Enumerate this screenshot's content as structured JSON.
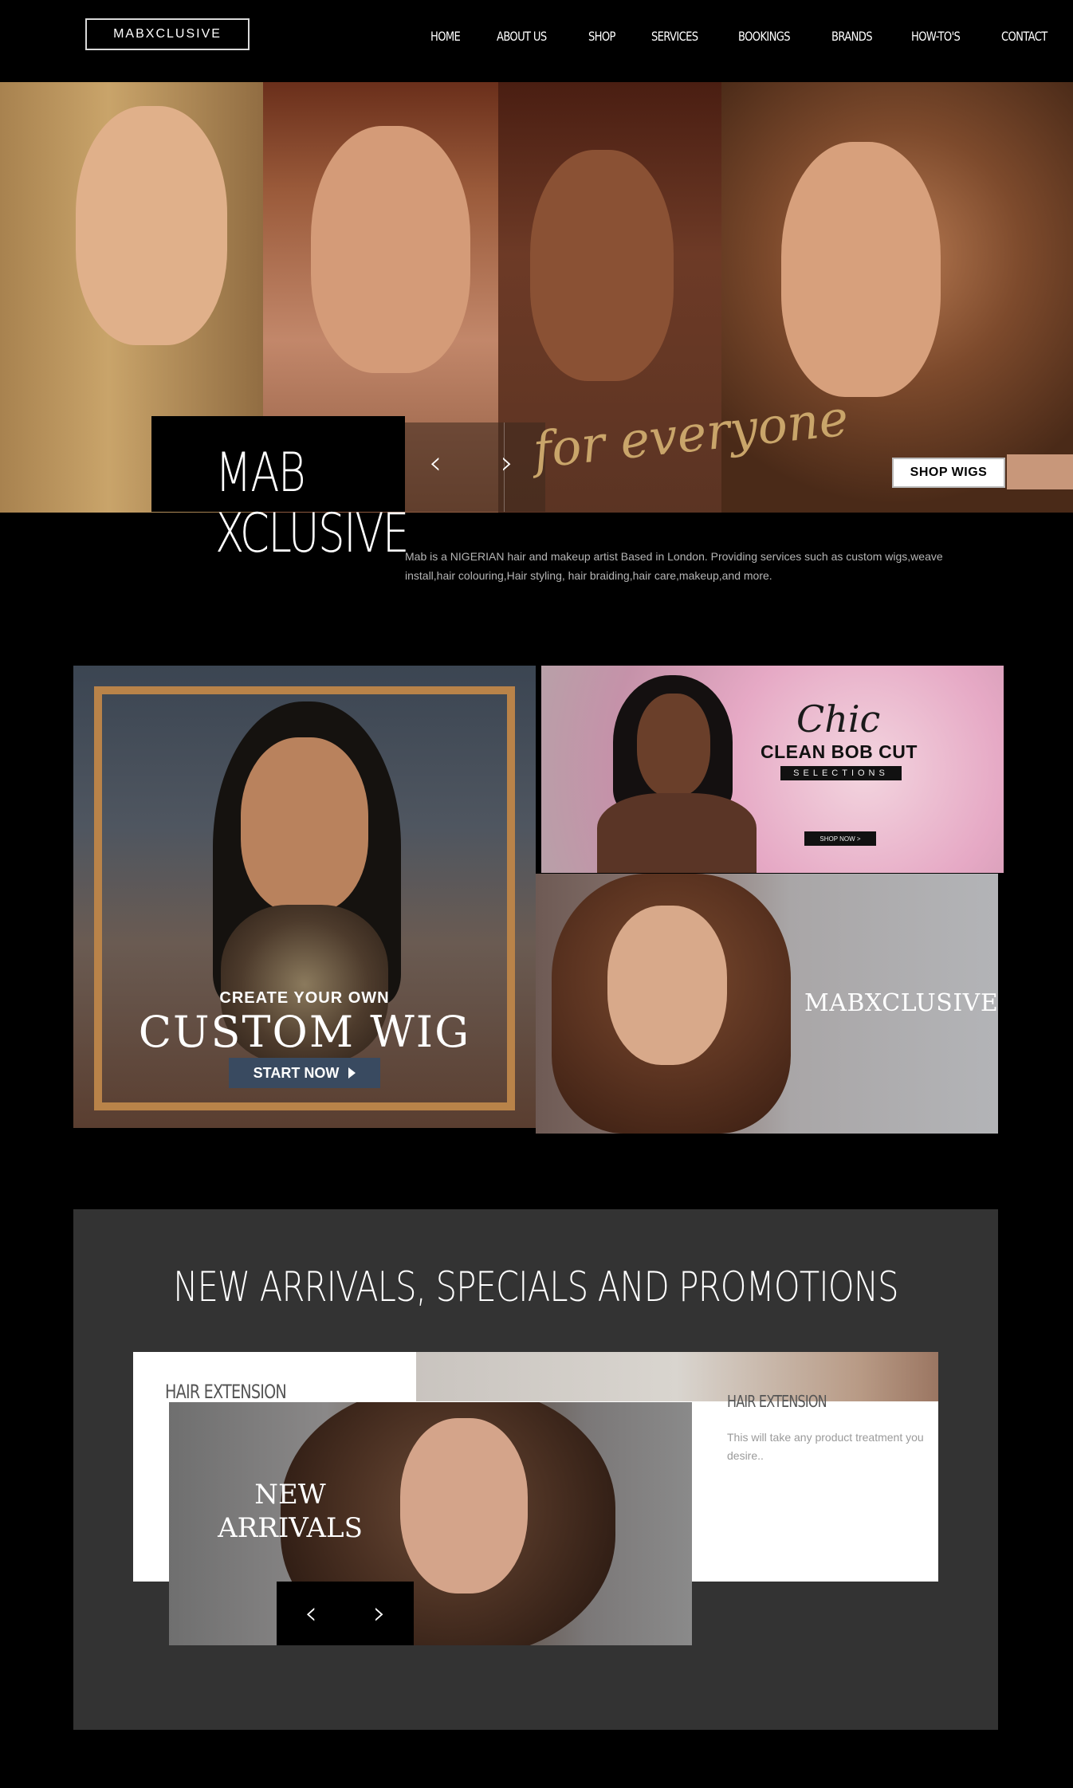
{
  "header": {
    "logo": "MABXCLUSIVE",
    "nav": [
      "HOME",
      "ABOUT US",
      "SHOP",
      "SERVICES",
      "BOOKINGS",
      "BRANDS",
      "HOW-TO'S",
      "CONTACT"
    ]
  },
  "hero": {
    "title_line1": "MAB",
    "title_line2": "XCLUSIVE",
    "tagline": "for everyone",
    "cta": "SHOP WIGS",
    "prev": "‹",
    "next": "›",
    "description": "Mab is a NIGERIAN hair and makeup artist Based in London. Providing services such as custom wigs,weave install,hair colouring,Hair styling, hair braiding,hair care,makeup,and more."
  },
  "promos": {
    "custom_wig": {
      "kicker": "CREATE YOUR OWN",
      "title": "CUSTOM WIG",
      "cta": "START NOW"
    },
    "bob": {
      "script": "Chic",
      "title": "CLEAN BOB CUT",
      "subtitle": "SELECTIONS",
      "cta": "SHOP NOW >"
    },
    "brand_banner": "MABXCLUSIVE"
  },
  "arrivals": {
    "heading": "NEW ARRIVALS, SPECIALS AND PROMOTIONS",
    "card_title": "HAIR EXTENSION",
    "card_title_2": "HAIR EXTENSION",
    "card_desc": "This will take any product treatment you desire..",
    "overlay_line1": "NEW",
    "overlay_line2": "ARRIVALS",
    "prev": "‹",
    "next": "›"
  },
  "colors": {
    "background": "#000000",
    "gold": "#c9a56a",
    "panel": "#333333",
    "wig_button": "#394a60"
  }
}
